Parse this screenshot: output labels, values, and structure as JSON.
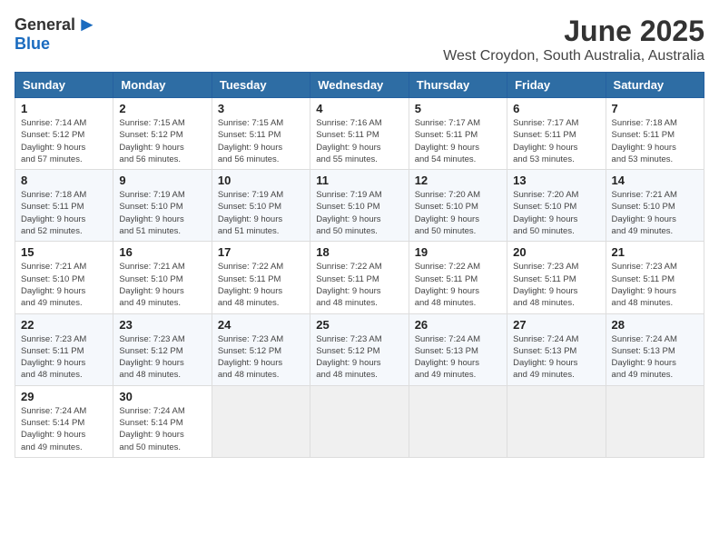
{
  "header": {
    "logo_general": "General",
    "logo_blue": "Blue",
    "month": "June 2025",
    "location": "West Croydon, South Australia, Australia"
  },
  "weekdays": [
    "Sunday",
    "Monday",
    "Tuesday",
    "Wednesday",
    "Thursday",
    "Friday",
    "Saturday"
  ],
  "weeks": [
    [
      {
        "day": "1",
        "info": "Sunrise: 7:14 AM\nSunset: 5:12 PM\nDaylight: 9 hours\nand 57 minutes."
      },
      {
        "day": "2",
        "info": "Sunrise: 7:15 AM\nSunset: 5:12 PM\nDaylight: 9 hours\nand 56 minutes."
      },
      {
        "day": "3",
        "info": "Sunrise: 7:15 AM\nSunset: 5:11 PM\nDaylight: 9 hours\nand 56 minutes."
      },
      {
        "day": "4",
        "info": "Sunrise: 7:16 AM\nSunset: 5:11 PM\nDaylight: 9 hours\nand 55 minutes."
      },
      {
        "day": "5",
        "info": "Sunrise: 7:17 AM\nSunset: 5:11 PM\nDaylight: 9 hours\nand 54 minutes."
      },
      {
        "day": "6",
        "info": "Sunrise: 7:17 AM\nSunset: 5:11 PM\nDaylight: 9 hours\nand 53 minutes."
      },
      {
        "day": "7",
        "info": "Sunrise: 7:18 AM\nSunset: 5:11 PM\nDaylight: 9 hours\nand 53 minutes."
      }
    ],
    [
      {
        "day": "8",
        "info": "Sunrise: 7:18 AM\nSunset: 5:11 PM\nDaylight: 9 hours\nand 52 minutes."
      },
      {
        "day": "9",
        "info": "Sunrise: 7:19 AM\nSunset: 5:10 PM\nDaylight: 9 hours\nand 51 minutes."
      },
      {
        "day": "10",
        "info": "Sunrise: 7:19 AM\nSunset: 5:10 PM\nDaylight: 9 hours\nand 51 minutes."
      },
      {
        "day": "11",
        "info": "Sunrise: 7:19 AM\nSunset: 5:10 PM\nDaylight: 9 hours\nand 50 minutes."
      },
      {
        "day": "12",
        "info": "Sunrise: 7:20 AM\nSunset: 5:10 PM\nDaylight: 9 hours\nand 50 minutes."
      },
      {
        "day": "13",
        "info": "Sunrise: 7:20 AM\nSunset: 5:10 PM\nDaylight: 9 hours\nand 50 minutes."
      },
      {
        "day": "14",
        "info": "Sunrise: 7:21 AM\nSunset: 5:10 PM\nDaylight: 9 hours\nand 49 minutes."
      }
    ],
    [
      {
        "day": "15",
        "info": "Sunrise: 7:21 AM\nSunset: 5:10 PM\nDaylight: 9 hours\nand 49 minutes."
      },
      {
        "day": "16",
        "info": "Sunrise: 7:21 AM\nSunset: 5:10 PM\nDaylight: 9 hours\nand 49 minutes."
      },
      {
        "day": "17",
        "info": "Sunrise: 7:22 AM\nSunset: 5:11 PM\nDaylight: 9 hours\nand 48 minutes."
      },
      {
        "day": "18",
        "info": "Sunrise: 7:22 AM\nSunset: 5:11 PM\nDaylight: 9 hours\nand 48 minutes."
      },
      {
        "day": "19",
        "info": "Sunrise: 7:22 AM\nSunset: 5:11 PM\nDaylight: 9 hours\nand 48 minutes."
      },
      {
        "day": "20",
        "info": "Sunrise: 7:23 AM\nSunset: 5:11 PM\nDaylight: 9 hours\nand 48 minutes."
      },
      {
        "day": "21",
        "info": "Sunrise: 7:23 AM\nSunset: 5:11 PM\nDaylight: 9 hours\nand 48 minutes."
      }
    ],
    [
      {
        "day": "22",
        "info": "Sunrise: 7:23 AM\nSunset: 5:11 PM\nDaylight: 9 hours\nand 48 minutes."
      },
      {
        "day": "23",
        "info": "Sunrise: 7:23 AM\nSunset: 5:12 PM\nDaylight: 9 hours\nand 48 minutes."
      },
      {
        "day": "24",
        "info": "Sunrise: 7:23 AM\nSunset: 5:12 PM\nDaylight: 9 hours\nand 48 minutes."
      },
      {
        "day": "25",
        "info": "Sunrise: 7:23 AM\nSunset: 5:12 PM\nDaylight: 9 hours\nand 48 minutes."
      },
      {
        "day": "26",
        "info": "Sunrise: 7:24 AM\nSunset: 5:13 PM\nDaylight: 9 hours\nand 49 minutes."
      },
      {
        "day": "27",
        "info": "Sunrise: 7:24 AM\nSunset: 5:13 PM\nDaylight: 9 hours\nand 49 minutes."
      },
      {
        "day": "28",
        "info": "Sunrise: 7:24 AM\nSunset: 5:13 PM\nDaylight: 9 hours\nand 49 minutes."
      }
    ],
    [
      {
        "day": "29",
        "info": "Sunrise: 7:24 AM\nSunset: 5:14 PM\nDaylight: 9 hours\nand 49 minutes."
      },
      {
        "day": "30",
        "info": "Sunrise: 7:24 AM\nSunset: 5:14 PM\nDaylight: 9 hours\nand 50 minutes."
      },
      {
        "day": "",
        "info": ""
      },
      {
        "day": "",
        "info": ""
      },
      {
        "day": "",
        "info": ""
      },
      {
        "day": "",
        "info": ""
      },
      {
        "day": "",
        "info": ""
      }
    ]
  ]
}
